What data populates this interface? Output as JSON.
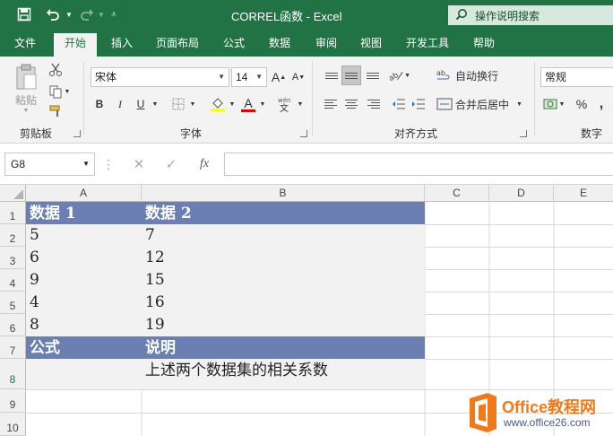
{
  "titlebar": {
    "title": "CORREL函数  -  Excel",
    "tell_me": "操作说明搜索"
  },
  "tabs": [
    "文件",
    "开始",
    "插入",
    "页面布局",
    "公式",
    "数据",
    "审阅",
    "视图",
    "开发工具",
    "帮助"
  ],
  "ribbon": {
    "clipboard": {
      "paste": "粘贴",
      "label": "剪贴板"
    },
    "font": {
      "name": "宋体",
      "size": "14",
      "label": "字体",
      "bold": "B",
      "italic": "I",
      "underline": "U",
      "font_color": "A",
      "grow": "A",
      "shrink": "A"
    },
    "alignment": {
      "wrap": "自动换行",
      "merge": "合并后居中",
      "label": "对齐方式"
    },
    "number": {
      "format": "常规",
      "label": "数字",
      "percent": "%",
      "comma": ","
    }
  },
  "formula_bar": {
    "name_box": "G8",
    "fx": "fx",
    "formula": ""
  },
  "columns": [
    "A",
    "B",
    "C",
    "D",
    "E"
  ],
  "rows": [
    "1",
    "2",
    "3",
    "4",
    "5",
    "6",
    "7",
    "8",
    "9",
    "10"
  ],
  "cells": {
    "A1": "数据 1",
    "B1": "数据 2",
    "A2": "5",
    "B2": "7",
    "A3": "6",
    "B3": "12",
    "A4": "9",
    "B4": "15",
    "A5": "4",
    "B5": "16",
    "A6": "8",
    "B6": "19",
    "A7": "公式",
    "B7": "说明",
    "A8": "",
    "B8": "上述两个数据集的相关系数"
  },
  "watermark": {
    "brand": "Office教程网",
    "url": "www.office26.com"
  },
  "colors": {
    "excel_green": "#217346",
    "header_fill": "#6b7fb3",
    "data_fill": "#f2f2f2",
    "watermark_orange": "#f07a1a"
  }
}
